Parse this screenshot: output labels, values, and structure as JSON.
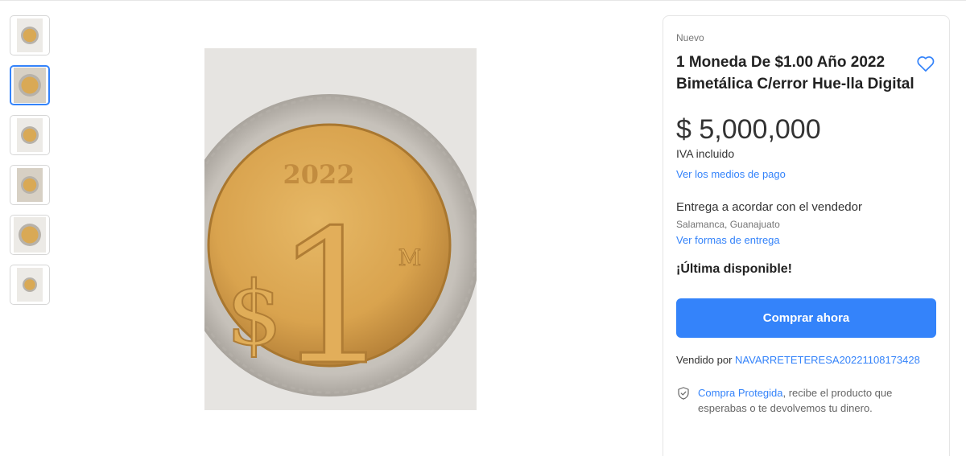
{
  "gallery": {
    "thumbnails": [
      {
        "label": "Imagen 1"
      },
      {
        "label": "Imagen 2"
      },
      {
        "label": "Imagen 3"
      },
      {
        "label": "Imagen 4"
      },
      {
        "label": "Imagen 5"
      },
      {
        "label": "Imagen 6"
      }
    ],
    "selected_index": 1,
    "main_image": {
      "coin_year": "2022",
      "coin_symbol": "$",
      "coin_value": "1",
      "mint_mark": "M"
    }
  },
  "product": {
    "condition": "Nuevo",
    "title": "1 Moneda De $1.00 Año 2022 Bimetálica C/error Hue-lla Digital",
    "price": "$ 5,000,000",
    "tax_note": "IVA incluido",
    "payment_link": "Ver los medios de pago",
    "delivery": "Entrega a acordar con el vendedor",
    "location": "Salamanca, Guanajuato",
    "delivery_link": "Ver formas de entrega",
    "stock": "¡Última disponible!",
    "buy_button": "Comprar ahora",
    "sold_by_label": "Vendido por",
    "seller_name": "NAVARRETETERESA20221108173428",
    "protected_link": "Compra Protegida",
    "protected_text": ", recibe el producto que esperabas o te devolvemos tu dinero."
  },
  "colors": {
    "accent": "#3483fa",
    "selected_border": "#3483fa",
    "coin_gold": "#d9a955",
    "coin_silver": "#c2beb8"
  },
  "icons": {
    "favorite": "heart-icon",
    "protection": "shield-check-icon"
  }
}
